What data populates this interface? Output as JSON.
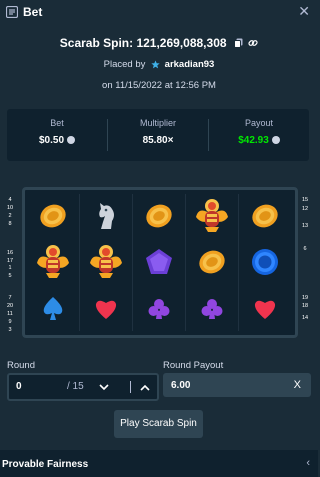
{
  "header": {
    "title": "Bet",
    "close_icon": "close-icon",
    "bet_icon": "bet-list-icon"
  },
  "spin": {
    "title": "Scarab Spin: 121,269,088,308",
    "copy_icon": "copy-icon",
    "link_icon": "link-icon"
  },
  "placed": {
    "prefix": "Placed by",
    "user": "arkadian93",
    "user_icon": "vip-star-icon",
    "date": "on 11/15/2022 at 12:56 PM"
  },
  "stats": {
    "bet_label": "Bet",
    "bet_value": "$0.50",
    "multiplier_label": "Multiplier",
    "multiplier_value": "85.80×",
    "payout_label": "Payout",
    "payout_value": "$42.93",
    "payout_color": "#00e701"
  },
  "paylines": {
    "left": [
      "4",
      "10",
      "2",
      "8",
      "16",
      "17",
      "1",
      "5",
      "7",
      "20",
      "11",
      "9",
      "3"
    ],
    "right": [
      "15",
      "12",
      "13",
      "6",
      "19",
      "18",
      "14"
    ]
  },
  "reels": [
    [
      "coin",
      "horse",
      "coin",
      "scarab",
      "coin"
    ],
    [
      "scarab",
      "scarab",
      "pentagon",
      "coin",
      "circle"
    ],
    [
      "spade",
      "heart",
      "club",
      "club",
      "heart"
    ]
  ],
  "controls": {
    "round_label": "Round",
    "round_value": "0",
    "round_total": "/ 15",
    "round_payout_label": "Round Payout",
    "round_payout_value": "6.00",
    "clear_label": "X",
    "play_label": "Play Scarab Spin"
  },
  "footer": {
    "label": "Provable Fairness",
    "chevron_icon": "chevron-left-icon"
  },
  "colors": {
    "background": "#1a2c38",
    "panel": "#0f212e",
    "border": "#2f4553",
    "accent_green": "#00e701"
  }
}
